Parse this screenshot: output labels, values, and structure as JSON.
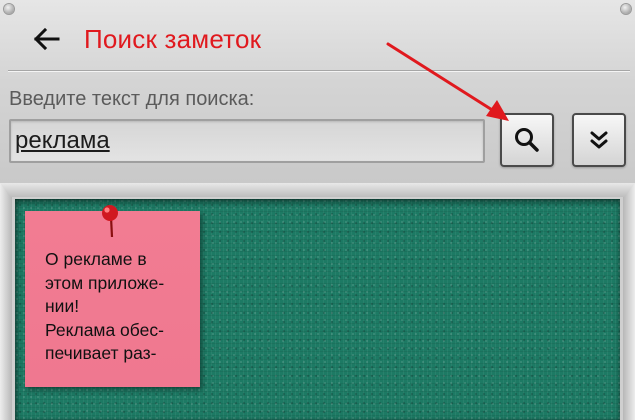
{
  "header": {
    "title": "Поиск заметок",
    "back_icon": "arrow-left-icon"
  },
  "search": {
    "label": "Введите текст для поиска:",
    "value": "реклама",
    "search_icon": "search-icon",
    "expand_icon": "double-chevron-down-icon"
  },
  "annotation": {
    "arrow_icon": "red-arrow-icon",
    "color": "#e0191e"
  },
  "notes": [
    {
      "text": "О рекламе в\nэтом приложе-\nнии!\nРеклама обес-\nпечивает раз-",
      "color": "#f27c92",
      "pin_icon": "pushpin-icon"
    }
  ],
  "colors": {
    "title": "#e0191e",
    "board": "#1d7a64",
    "note": "#f27c92"
  }
}
